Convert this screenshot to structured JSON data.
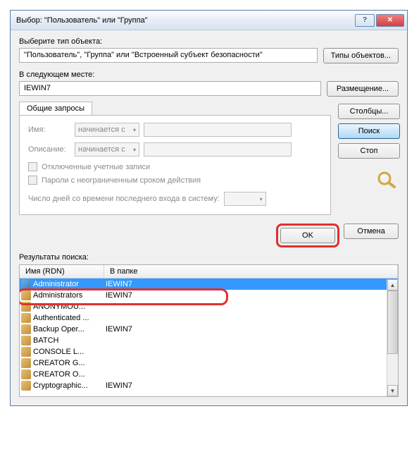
{
  "window": {
    "title": "Выбор: \"Пользователь\" или \"Группа\""
  },
  "section1": {
    "label": "Выберите тип объекта:",
    "value": "\"Пользователь\", \"Группа\" или \"Встроенный субъект безопасности\"",
    "button": "Типы объектов..."
  },
  "section2": {
    "label": "В следующем месте:",
    "value": "IEWIN7",
    "button": "Размещение..."
  },
  "tab": {
    "label": "Общие запросы"
  },
  "form": {
    "name_label": "Имя:",
    "name_combo": "начинается с",
    "desc_label": "Описание:",
    "desc_combo": "начинается с",
    "chk1": "Отключенные учетные записи",
    "chk2": "Пароли с неограниченным сроком действия",
    "days_label": "Число дней со времени последнего входа в систему:"
  },
  "sidebuttons": {
    "columns": "Столбцы...",
    "search": "Поиск",
    "stop": "Стоп"
  },
  "bottom": {
    "ok": "OK",
    "cancel": "Отмена"
  },
  "results": {
    "label": "Результаты поиска:",
    "col_name": "Имя (RDN)",
    "col_folder": "В папке",
    "rows": [
      {
        "name": "Administrator",
        "folder": "IEWIN7",
        "icon": "user",
        "selected": true
      },
      {
        "name": "Administrators",
        "folder": "IEWIN7",
        "icon": "group"
      },
      {
        "name": "ANONYMOU...",
        "folder": "",
        "icon": "group"
      },
      {
        "name": "Authenticated ...",
        "folder": "",
        "icon": "group"
      },
      {
        "name": "Backup Oper...",
        "folder": "IEWIN7",
        "icon": "group"
      },
      {
        "name": "BATCH",
        "folder": "",
        "icon": "group"
      },
      {
        "name": "CONSOLE L...",
        "folder": "",
        "icon": "group"
      },
      {
        "name": "CREATOR G...",
        "folder": "",
        "icon": "group"
      },
      {
        "name": "CREATOR O...",
        "folder": "",
        "icon": "group"
      },
      {
        "name": "Cryptographic...",
        "folder": "IEWIN7",
        "icon": "group"
      }
    ]
  }
}
